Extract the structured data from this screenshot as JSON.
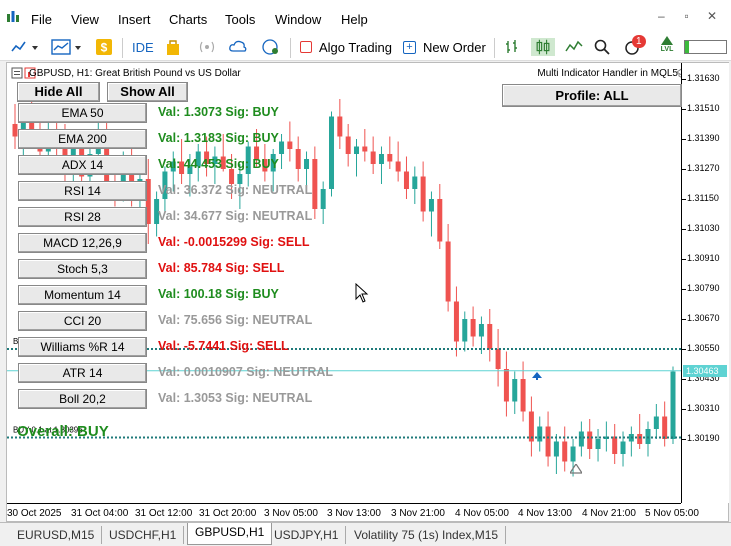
{
  "menu": {
    "items": [
      "File",
      "View",
      "Insert",
      "Charts",
      "Tools",
      "Window",
      "Help"
    ],
    "window_controls": [
      "–",
      "▫",
      "✕"
    ]
  },
  "toolbar": {
    "ide_label": "IDE",
    "algo_trading_label": "Algo Trading",
    "new_order_label": "New Order",
    "notification_count": "1",
    "level_label": "LVL"
  },
  "chart": {
    "symbol_line": "GBPUSD, H1:  Great British Pound vs US Dollar",
    "multi_indicator_label": "Multi Indicator Handler in MQL5",
    "price_labels": [
      "1.31630",
      "1.31510",
      "1.31390",
      "1.31270",
      "1.31150",
      "1.31030",
      "1.30910",
      "1.30790",
      "1.30670",
      "1.30550",
      "1.30430",
      "1.30310",
      "1.30190"
    ],
    "current_price": "1.30463",
    "time_labels": [
      "30 Oct 2025",
      "31 Oct 04:00",
      "31 Oct 12:00",
      "31 Oct 20:00",
      "3 Nov 05:00",
      "3 Nov 13:00",
      "3 Nov 21:00",
      "4 Nov 05:00",
      "4 Nov 13:00",
      "4 Nov 21:00",
      "5 Nov 05:00"
    ],
    "buy_line_label": "BUY 0.1 at 1.30396",
    "buy_line_label_top": "BUY 0.1 at 1.30785"
  },
  "panel": {
    "hide_all": "Hide All",
    "show_all": "Show All",
    "profile": "Profile: ALL",
    "indicators": [
      {
        "name": "EMA 50",
        "val": "Val: 1.3073  Sig: BUY",
        "color": "#1e8c1e"
      },
      {
        "name": "EMA 200",
        "val": "Val: 1.3183  Sig: BUY",
        "color": "#1e8c1e"
      },
      {
        "name": "ADX 14",
        "val": "Val: 44.453  Sig: BUY",
        "color": "#1e8c1e"
      },
      {
        "name": "RSI 14",
        "val": "Val: 36.372  Sig: NEUTRAL",
        "color": "#999999"
      },
      {
        "name": "RSI 28",
        "val": "Val: 34.677  Sig: NEUTRAL",
        "color": "#999999"
      },
      {
        "name": "MACD 12,26,9",
        "val": "Val: -0.0015299  Sig: SELL",
        "color": "#e01010"
      },
      {
        "name": "Stoch 5,3",
        "val": "Val: 85.784  Sig: SELL",
        "color": "#e01010"
      },
      {
        "name": "Momentum 14",
        "val": "Val: 100.18  Sig: BUY",
        "color": "#1e8c1e"
      },
      {
        "name": "CCI 20",
        "val": "Val: 75.656  Sig: NEUTRAL",
        "color": "#999999"
      },
      {
        "name": "Williams %R 14",
        "val": "Val: -5.7441  Sig: SELL",
        "color": "#e01010"
      },
      {
        "name": "ATR 14",
        "val": "Val: 0.0010907  Sig: NEUTRAL",
        "color": "#999999"
      },
      {
        "name": "Boll 20,2",
        "val": "Val: 1.3053  Sig: NEUTRAL",
        "color": "#999999"
      }
    ],
    "overall": "Overall: BUY"
  },
  "bottom_tabs": [
    {
      "label": "EURUSD,M15",
      "active": false
    },
    {
      "label": "USDCHF,H1",
      "active": false
    },
    {
      "label": "GBPUSD,H1",
      "active": true
    },
    {
      "label": "USDJPY,H1",
      "active": false
    },
    {
      "label": "Volatility 75 (1s) Index,M15",
      "active": false
    }
  ],
  "colors": {
    "bull_candle": "#26a69a",
    "bear_candle": "#ef5350",
    "buy_line": "#1f7a7a",
    "bid_line": "#5fd3d3"
  },
  "candles": [
    [
      1.3145,
      1.3153,
      1.3135,
      1.314
    ],
    [
      1.3141,
      1.3152,
      1.3132,
      1.3149
    ],
    [
      1.3149,
      1.3156,
      1.314,
      1.3142
    ],
    [
      1.3142,
      1.315,
      1.3128,
      1.3134
    ],
    [
      1.3134,
      1.3146,
      1.3126,
      1.3143
    ],
    [
      1.3143,
      1.3149,
      1.3131,
      1.3136
    ],
    [
      1.3136,
      1.3145,
      1.3122,
      1.3128
    ],
    [
      1.3128,
      1.314,
      1.312,
      1.3137
    ],
    [
      1.3137,
      1.3142,
      1.3118,
      1.3124
    ],
    [
      1.3124,
      1.3138,
      1.3115,
      1.3133
    ],
    [
      1.3133,
      1.3148,
      1.3125,
      1.3141
    ],
    [
      1.3141,
      1.3147,
      1.3118,
      1.3122
    ],
    [
      1.3122,
      1.313,
      1.3112,
      1.3118
    ],
    [
      1.3118,
      1.3134,
      1.3114,
      1.3129
    ],
    [
      1.3129,
      1.3136,
      1.3112,
      1.3116
    ],
    [
      1.3116,
      1.3129,
      1.3106,
      1.3123
    ],
    [
      1.3123,
      1.3131,
      1.3097,
      1.3105
    ],
    [
      1.3105,
      1.3118,
      1.31,
      1.3115
    ],
    [
      1.3115,
      1.3128,
      1.311,
      1.3126
    ],
    [
      1.3126,
      1.3134,
      1.3118,
      1.313
    ],
    [
      1.313,
      1.3139,
      1.3121,
      1.3125
    ],
    [
      1.3125,
      1.3133,
      1.3116,
      1.3128
    ],
    [
      1.3128,
      1.3137,
      1.3122,
      1.3134
    ],
    [
      1.3134,
      1.314,
      1.3124,
      1.3129
    ],
    [
      1.3129,
      1.3136,
      1.3121,
      1.3132
    ],
    [
      1.3132,
      1.3141,
      1.3126,
      1.3127
    ],
    [
      1.3127,
      1.3133,
      1.3115,
      1.3121
    ],
    [
      1.3121,
      1.3129,
      1.3111,
      1.3125
    ],
    [
      1.3125,
      1.3138,
      1.312,
      1.3136
    ],
    [
      1.3136,
      1.3143,
      1.3128,
      1.3131
    ],
    [
      1.3131,
      1.3137,
      1.3122,
      1.3126
    ],
    [
      1.3126,
      1.3135,
      1.3118,
      1.3133
    ],
    [
      1.3133,
      1.3141,
      1.3127,
      1.3138
    ],
    [
      1.3138,
      1.3146,
      1.313,
      1.3135
    ],
    [
      1.3135,
      1.314,
      1.3122,
      1.3127
    ],
    [
      1.3127,
      1.3134,
      1.3119,
      1.3131
    ],
    [
      1.3131,
      1.3136,
      1.3107,
      1.3111
    ],
    [
      1.3111,
      1.3122,
      1.3105,
      1.3119
    ],
    [
      1.3119,
      1.315,
      1.3116,
      1.3148
    ],
    [
      1.3148,
      1.3155,
      1.3135,
      1.314
    ],
    [
      1.314,
      1.3145,
      1.3128,
      1.3133
    ],
    [
      1.3133,
      1.3139,
      1.3124,
      1.3136
    ],
    [
      1.3136,
      1.3143,
      1.313,
      1.3134
    ],
    [
      1.3134,
      1.314,
      1.3125,
      1.3129
    ],
    [
      1.3129,
      1.3136,
      1.3121,
      1.3133
    ],
    [
      1.3133,
      1.314,
      1.3127,
      1.313
    ],
    [
      1.313,
      1.3138,
      1.3122,
      1.3126
    ],
    [
      1.3126,
      1.3132,
      1.3115,
      1.3119
    ],
    [
      1.3119,
      1.3128,
      1.3113,
      1.3124
    ],
    [
      1.3124,
      1.313,
      1.3106,
      1.311
    ],
    [
      1.311,
      1.3118,
      1.31,
      1.3115
    ],
    [
      1.3115,
      1.3121,
      1.3095,
      1.3098
    ],
    [
      1.3098,
      1.3105,
      1.307,
      1.3074
    ],
    [
      1.3074,
      1.308,
      1.3052,
      1.3058
    ],
    [
      1.3058,
      1.307,
      1.3054,
      1.3067
    ],
    [
      1.3067,
      1.3072,
      1.3056,
      1.306
    ],
    [
      1.306,
      1.3068,
      1.3053,
      1.3065
    ],
    [
      1.3065,
      1.3071,
      1.305,
      1.3055
    ],
    [
      1.3055,
      1.3063,
      1.304,
      1.3047
    ],
    [
      1.3047,
      1.3054,
      1.3028,
      1.3034
    ],
    [
      1.3034,
      1.3046,
      1.3029,
      1.3043
    ],
    [
      1.3043,
      1.305,
      1.3026,
      1.303
    ],
    [
      1.303,
      1.3036,
      1.3012,
      1.3018
    ],
    [
      1.3018,
      1.3028,
      1.3014,
      1.3024
    ],
    [
      1.3024,
      1.303,
      1.3008,
      1.3012
    ],
    [
      1.3012,
      1.3021,
      1.3005,
      1.3018
    ],
    [
      1.3018,
      1.3024,
      1.3006,
      1.301
    ],
    [
      1.301,
      1.3019,
      1.3004,
      1.3016
    ],
    [
      1.3016,
      1.3026,
      1.3012,
      1.3022
    ],
    [
      1.3022,
      1.3027,
      1.3011,
      1.3015
    ],
    [
      1.3015,
      1.3023,
      1.301,
      1.3019
    ],
    [
      1.3019,
      1.3026,
      1.3014,
      1.302
    ],
    [
      1.302,
      1.3025,
      1.3009,
      1.3013
    ],
    [
      1.3013,
      1.3022,
      1.3008,
      1.3018
    ],
    [
      1.3018,
      1.3024,
      1.3012,
      1.3021
    ],
    [
      1.3021,
      1.3029,
      1.3015,
      1.3017
    ],
    [
      1.3017,
      1.3026,
      1.3012,
      1.3023
    ],
    [
      1.3023,
      1.3033,
      1.3019,
      1.3028
    ],
    [
      1.3028,
      1.3034,
      1.3016,
      1.3019
    ],
    [
      1.3019,
      1.3048,
      1.3017,
      1.3046
    ]
  ]
}
